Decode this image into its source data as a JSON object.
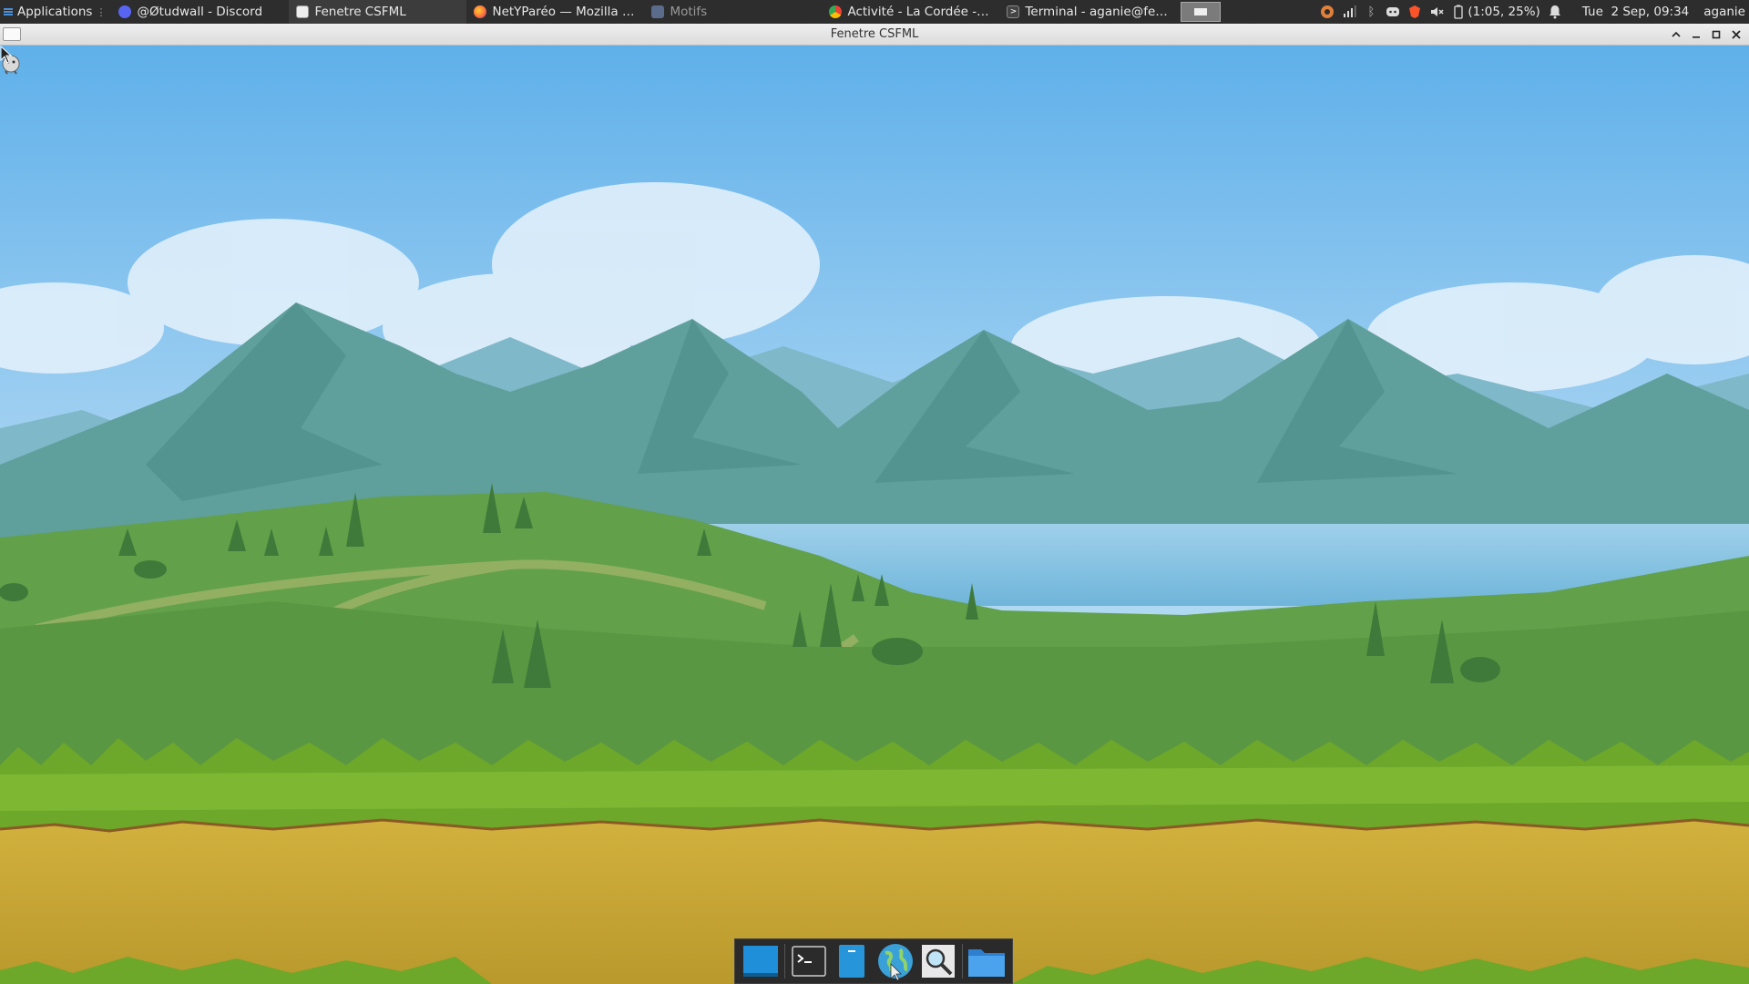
{
  "panel": {
    "apps_label": "Applications",
    "tasks": [
      {
        "label": "@Øtudwall - Discord",
        "icon": "discord-icon",
        "color": "#5865f2"
      },
      {
        "label": "Fenetre CSFML",
        "icon": "window-icon",
        "color": "#dddddd"
      },
      {
        "label": "NetYParéo — Mozilla Fire...",
        "icon": "firefox-icon",
        "color": "#ff7139"
      },
      {
        "label": "Motifs",
        "icon": "folder-icon",
        "color": "#5b6b8c"
      },
      {
        "label": "Activité - La Cordée - Goo...",
        "icon": "chrome-icon",
        "color": "#34a853"
      },
      {
        "label": "Terminal - aganie@fedor...",
        "icon": "terminal-icon",
        "color": "#444444"
      }
    ],
    "battery": "(1:05, 25%)",
    "clock": "Tue  2 Sep, 09:34",
    "user": "aganie"
  },
  "window": {
    "title": "Fenetre CSFML"
  },
  "dock": {
    "items": [
      "show-desktop-icon",
      "terminal-icon",
      "file-manager-icon",
      "web-browser-icon",
      "app-finder-icon",
      "folder-icon"
    ]
  },
  "colors": {
    "sky": "#7ec0ee",
    "mountain": "#5b9e9a",
    "hill": "#5e9a45",
    "grass": "#6fa82a",
    "dirt": "#c9a937"
  }
}
